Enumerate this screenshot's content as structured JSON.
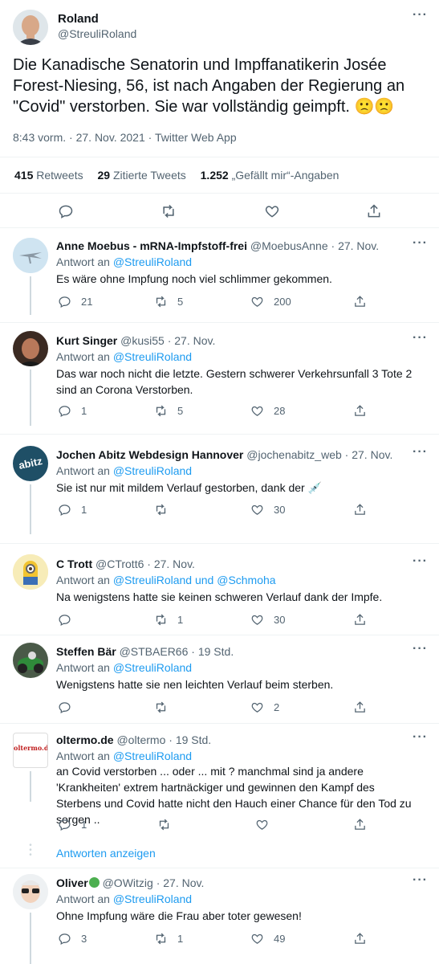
{
  "main": {
    "author_name": "Roland",
    "author_handle": "@StreuliRoland",
    "text": "Die Kanadische Senatorin und Impffanatikerin Josée Forest-Niesing, 56, ist nach Angaben der Regierung an \"Covid\" verstorben. Sie war vollständig geimpft.",
    "emojis": "🙁🙁",
    "time": "8:43 vorm.",
    "sep": "·",
    "date": "27. Nov. 2021",
    "source": "Twitter Web App",
    "retweets_count": "415",
    "retweets_label": "Retweets",
    "quotes_count": "29",
    "quotes_label": "Zitierte Tweets",
    "likes_count": "1.252",
    "likes_label": "„Gefällt mir“-Angaben"
  },
  "reply_prefix": "Antwort an",
  "replies": [
    {
      "name": "Anne Moebus - mRNA-Impfstoff-frei",
      "handle": "@MoebusAnne",
      "time": "27. Nov.",
      "reply_to": "@StreuliRoland",
      "text": "Es wäre ohne Impfung noch viel schlimmer gekommen.",
      "reply_count": "21",
      "retweet_count": "5",
      "like_count": "200"
    },
    {
      "name": "Kurt Singer",
      "handle": "@kusi55",
      "time": "27. Nov.",
      "reply_to": "@StreuliRoland",
      "text": "Das war noch nicht die letzte. Gestern schwerer Verkehrsunfall 3 Tote 2 sind an Corona Verstorben.",
      "reply_count": "1",
      "retweet_count": "5",
      "like_count": "28"
    },
    {
      "name": "Jochen Abitz Webdesign Hannover",
      "handle": "@jochenabitz_web",
      "time": "27. Nov.",
      "reply_to": "@StreuliRoland",
      "text": "Sie ist nur mit mildem Verlauf gestorben, dank der 💉",
      "reply_count": "1",
      "retweet_count": "",
      "like_count": "30"
    },
    {
      "name": "C Trott",
      "handle": "@CTrott6",
      "time": "27. Nov.",
      "reply_to": "@StreuliRoland und @Schmoha",
      "text": "Na wenigstens hatte sie keinen schweren Verlauf dank der Impfe.",
      "reply_count": "",
      "retweet_count": "1",
      "like_count": "30"
    },
    {
      "name": "Steffen Bär",
      "handle": "@STBAER66",
      "time": "19 Std.",
      "reply_to": "@StreuliRoland",
      "text": "Wenigstens hatte sie nen leichten Verlauf beim sterben.",
      "reply_count": "",
      "retweet_count": "",
      "like_count": "2"
    },
    {
      "name": "oltermo.de",
      "handle": "@oltermo",
      "time": "19 Std.",
      "reply_to": "@StreuliRoland",
      "text": "an Covid verstorben ... oder ... mit ? manchmal sind ja andere 'Krankheiten' extrem hartnäckiger und gewinnen den Kampf des Sterbens und Covid hatte nicht den Hauch einer Chance für den Tod zu sorgen ..",
      "reply_count": "1",
      "retweet_count": "",
      "like_count": ""
    },
    {
      "name": "Oliver",
      "handle": "@OWitzig",
      "time": "27. Nov.",
      "reply_to": "@StreuliRoland",
      "text": "Ohne Impfung wäre die Frau aber toter gewesen!",
      "reply_count": "3",
      "retweet_count": "1",
      "like_count": "49"
    }
  ],
  "show_replies_label": "Antworten anzeigen",
  "avatar_labels": {
    "abitz": "abitz",
    "oltermo": "oltermo.de"
  },
  "colors": {
    "accent": "#1d9bf0",
    "muted": "#536471",
    "divider": "#eff3f4"
  }
}
